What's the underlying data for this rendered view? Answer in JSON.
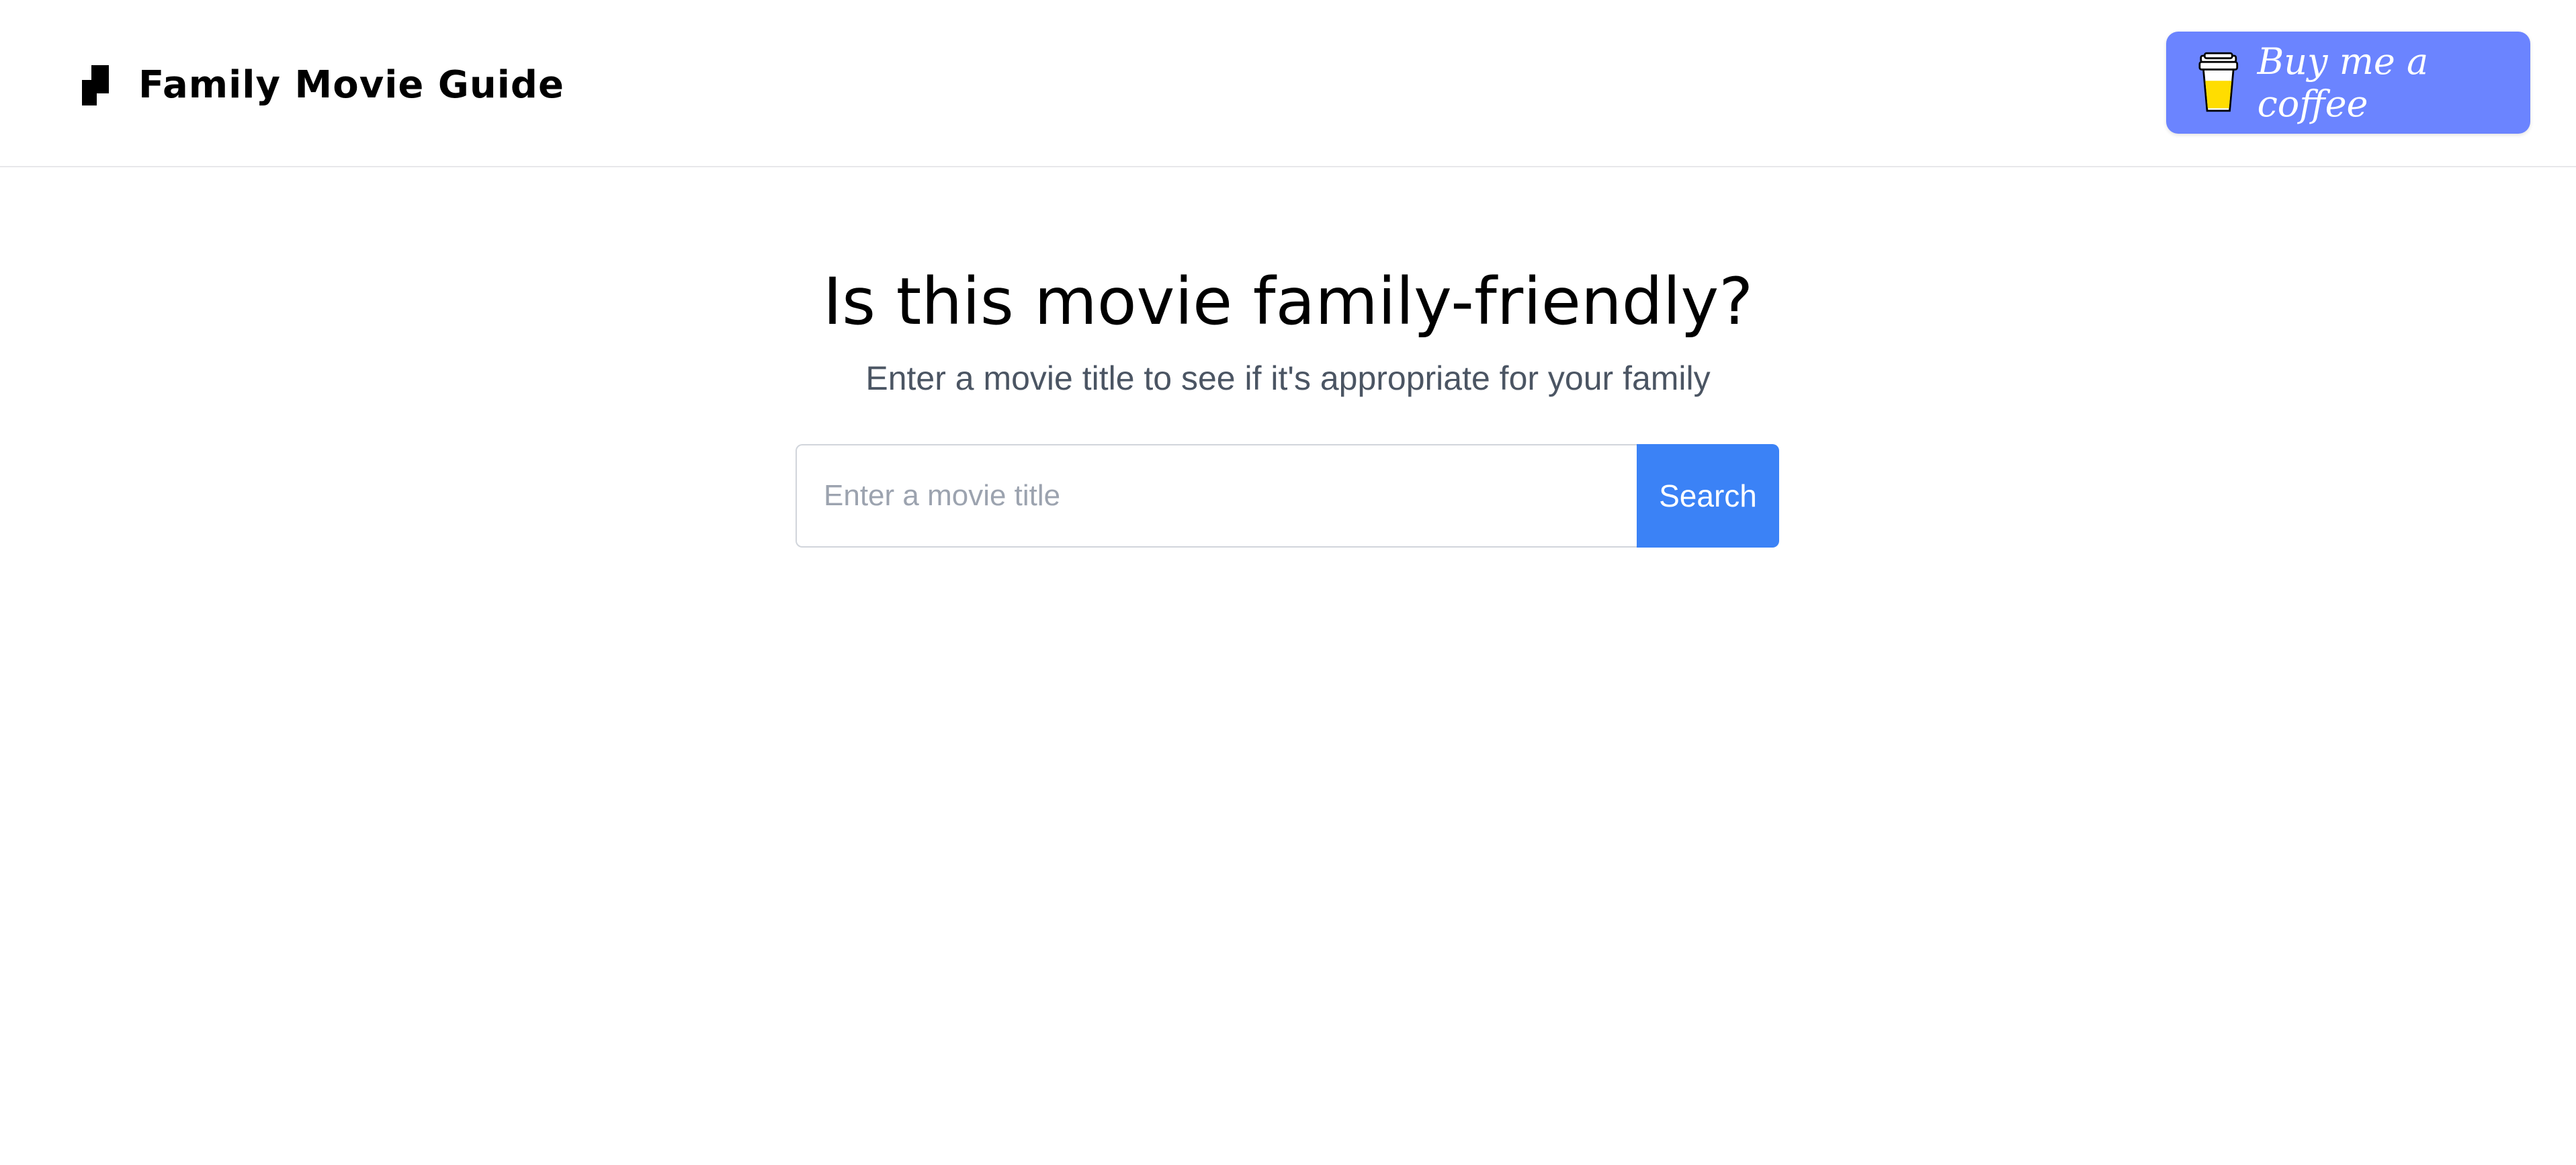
{
  "header": {
    "site_title": "Family Movie Guide",
    "logo_icon": "film-logo-icon",
    "coffee_button": {
      "label": "Buy me a coffee",
      "icon": "coffee-cup-icon",
      "color": "#6b84ff"
    }
  },
  "hero": {
    "title": "Is this movie family-friendly?",
    "subtitle": "Enter a movie title to see if it's appropriate for your family"
  },
  "search": {
    "placeholder": "Enter a movie title",
    "value": "",
    "button_label": "Search",
    "button_color": "#3b82f6"
  }
}
